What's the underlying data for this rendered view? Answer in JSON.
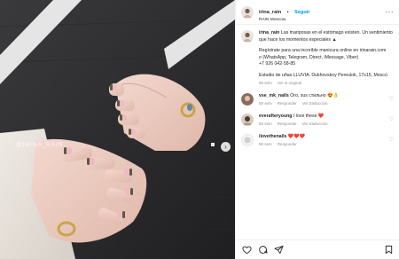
{
  "media": {
    "watermark": "@IRINA_RAIN",
    "next_icon": "chevron-right-icon"
  },
  "header": {
    "username": "irina_rain",
    "separator": "•",
    "follow_label": "Seguir",
    "location": "RAIN Moscow",
    "more_icon": "more-horizontal-icon"
  },
  "caption": {
    "username": "irina_rain",
    "text_line1": "Las mariposas en el estómago existen. Un sentimiento",
    "text_line2": "que hace los momentos especiales ▲",
    "text_line3": "Regístrate para una increíble manicura online en irinarain.com",
    "text_line4": "o (WhatsApp, Telegram, Direct, iMessage, Viber)",
    "text_line5": "+7 926 042-58-85",
    "text_line6": "Estudio de uñas LLUVIA. Dukhovskoy Pereulok, 17s15, Moscú",
    "time": "90 sem",
    "translation": "Ver el original"
  },
  "comments": [
    {
      "username": "vse_mk_nails",
      "text": "Oro, sus стильно 😍👌",
      "time": "59 sem",
      "reply": "Responder",
      "translation": "Ver traducción"
    },
    {
      "username": "everafteryoung",
      "text": "I love these ❤️",
      "time": "90 sem",
      "reply": "Responder",
      "translation": "Ver traducción"
    },
    {
      "username": "ilovethenails",
      "text": "❤️❤️❤️",
      "time": "90 sem",
      "reply": "Responder"
    }
  ],
  "colors": {
    "accent": "#0095f6",
    "muted": "#8e8e8e"
  }
}
